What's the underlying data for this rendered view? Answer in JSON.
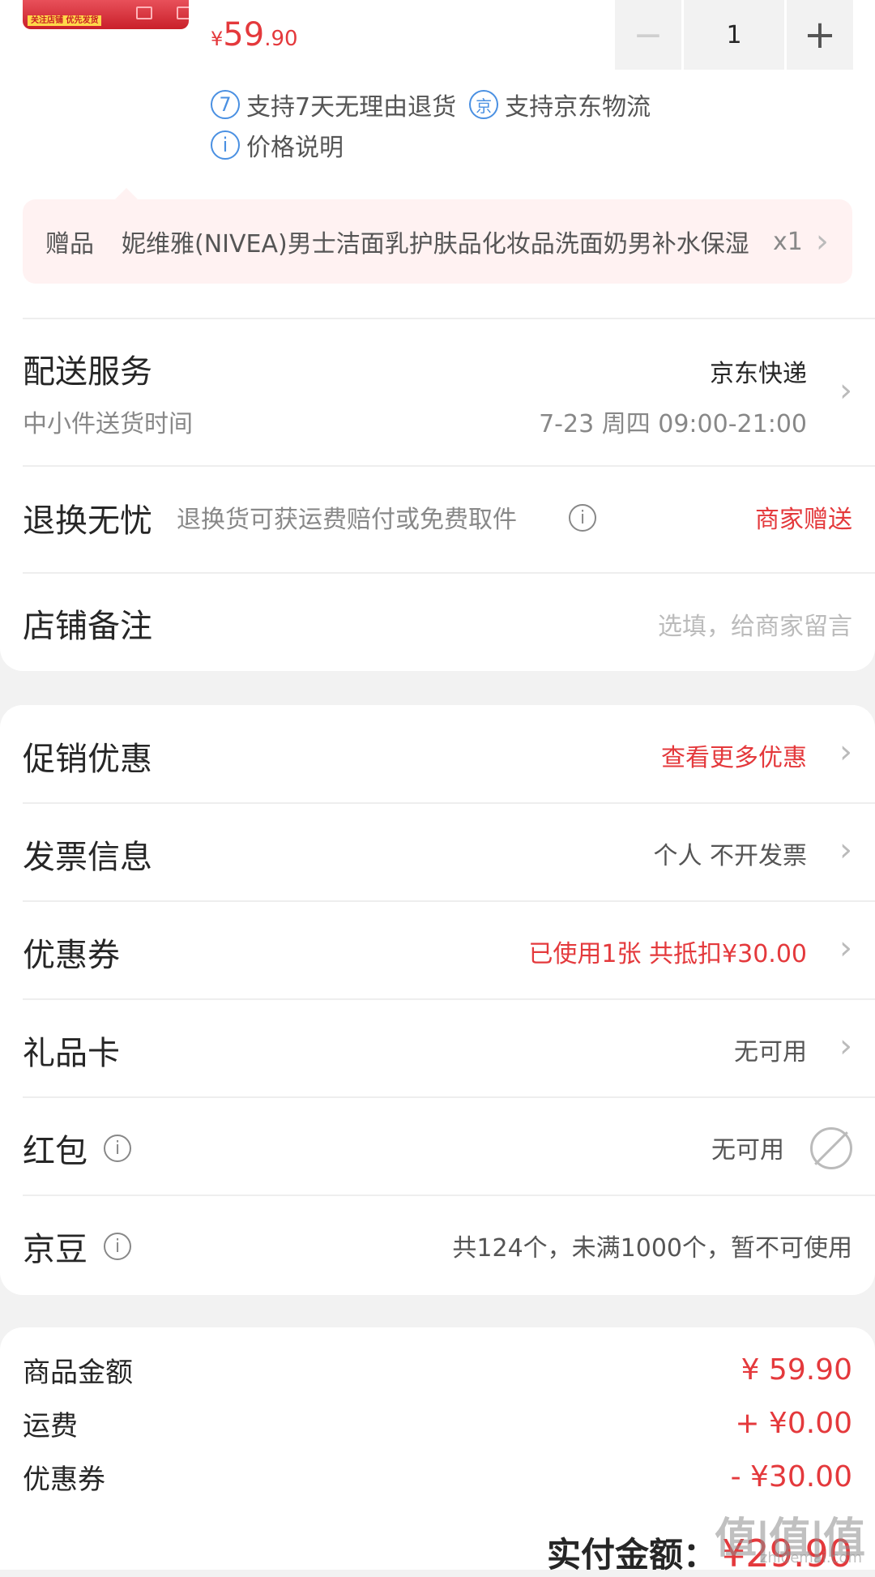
{
  "product": {
    "thumb_tag": "关注店铺 优先发货",
    "price_symbol": "¥",
    "price_int": "59",
    "price_dec": ".90",
    "quantity": "1",
    "minus": "−",
    "plus": "+",
    "tags": [
      {
        "icon": "7",
        "text": "支持7天无理由退货"
      },
      {
        "icon": "京",
        "text": "支持京东物流"
      },
      {
        "icon": "i",
        "text": "价格说明"
      }
    ]
  },
  "gift": {
    "label": "赠品",
    "name": "妮维雅(NIVEA)男士洁面乳护肤品化妆品洗面奶男补水保湿",
    "count": "x1"
  },
  "delivery": {
    "title": "配送服务",
    "carrier": "京东快递",
    "time_label": "中小件送货时间",
    "time_value": "7-23 周四 09:00-21:00"
  },
  "returns": {
    "title": "退换无忧",
    "desc": "退换货可获运费赔付或免费取件",
    "value": "商家赠送"
  },
  "note": {
    "title": "店铺备注",
    "placeholder": "选填，给商家留言"
  },
  "promo": {
    "title": "促销优惠",
    "value": "查看更多优惠"
  },
  "invoice": {
    "title": "发票信息",
    "value": "个人 不开发票"
  },
  "coupon": {
    "title": "优惠券",
    "value": "已使用1张 共抵扣¥30.00"
  },
  "giftcard": {
    "title": "礼品卡",
    "value": "无可用"
  },
  "redpacket": {
    "title": "红包",
    "value": "无可用"
  },
  "jingdou": {
    "title": "京豆",
    "value": "共124个，未满1000个，暂不可使用"
  },
  "summary": {
    "goods_label": "商品金额",
    "goods_value": "¥ 59.90",
    "shipping_label": "运费",
    "shipping_value": "+ ¥0.00",
    "coupon_label": "优惠券",
    "coupon_value": "- ¥30.00",
    "total_label": "实付金额：",
    "total_value": "¥29.90"
  },
  "watermark": {
    "mark": "值|值|值",
    "site": "zhidemai.com"
  },
  "colors": {
    "accent": "#e4393c",
    "info_blue": "#4a90e2"
  }
}
